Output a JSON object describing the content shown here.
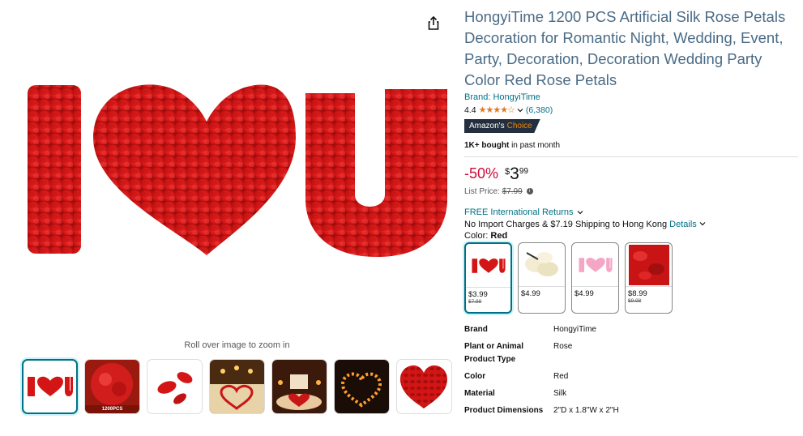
{
  "product": {
    "title": "HongyiTime 1200 PCS Artificial Silk Rose Petals Decoration for Romantic Night, Wedding, Event, Party, Decoration, Decoration Wedding Party Color Red Rose Petals",
    "brand_link": "Brand: HongyiTime",
    "rating": "4.4",
    "stars": "★★★★☆",
    "rating_count": "(6,380)",
    "badge_prefix": "Amazon's",
    "badge_word": "Choice",
    "bought_bold": "1K+ bought",
    "bought_rest": "in past month"
  },
  "price": {
    "discount": "-50%",
    "symbol": "$",
    "whole": "3",
    "fraction": "99",
    "list_label": "List Price:",
    "list_value": "$7.99"
  },
  "shipping": {
    "returns": "FREE International Returns",
    "import": "No Import Charges & $7.19 Shipping to Hong Kong",
    "details": "Details"
  },
  "color": {
    "label": "Color:",
    "selected": "Red",
    "options": [
      {
        "price": "$3.99",
        "old": "$7.99"
      },
      {
        "price": "$4.99",
        "old": ""
      },
      {
        "price": "$4.99",
        "old": ""
      },
      {
        "price": "$8.99",
        "old": "$9.98"
      }
    ]
  },
  "gallery": {
    "zoom_hint": "Roll over image to zoom in",
    "thumb_caption": "1200PCS"
  },
  "specs": [
    {
      "key": "Brand",
      "value": "HongyiTime"
    },
    {
      "key": "Plant or Animal Product Type",
      "value": "Rose"
    },
    {
      "key": "Color",
      "value": "Red"
    },
    {
      "key": "Material",
      "value": "Silk"
    },
    {
      "key": "Product Dimensions",
      "value": "2\"D x 1.8\"W x 2\"H"
    }
  ],
  "colors": {
    "link": "#007185",
    "title": "#4a6b85",
    "discount": "#cc0c39",
    "star": "#de7921",
    "petal_red": "#d81818"
  },
  "icons": {
    "share": "share-icon",
    "chevron": "chevron-down-icon",
    "info": "info-icon"
  }
}
